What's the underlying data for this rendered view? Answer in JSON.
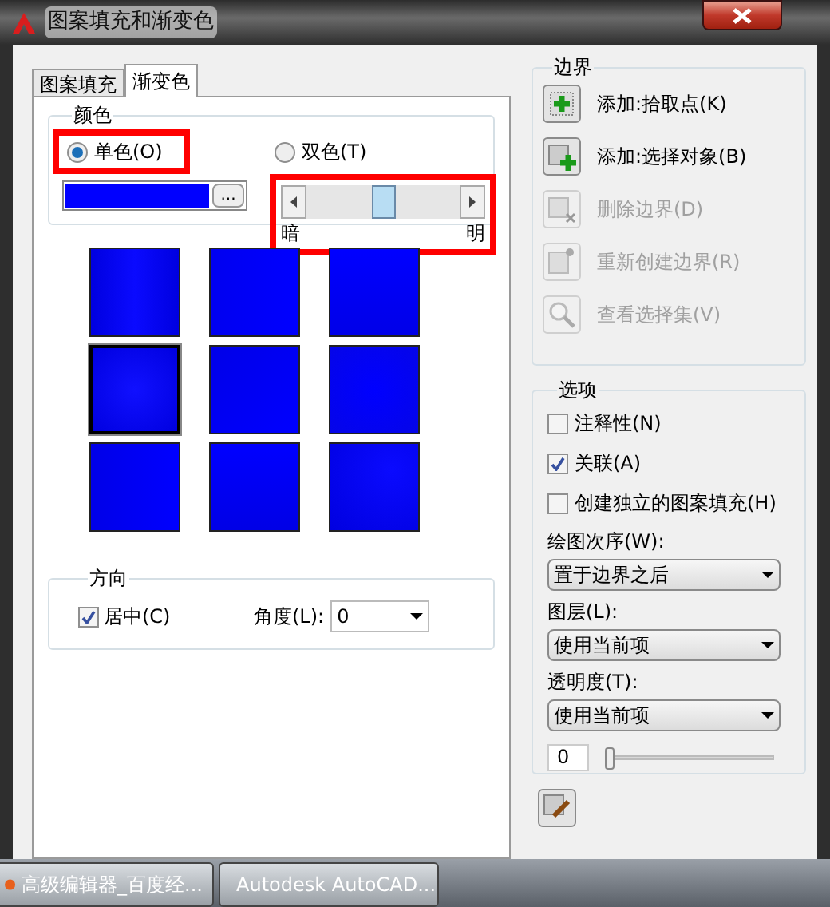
{
  "window": {
    "title": "图案填充和渐变色"
  },
  "tabs": [
    {
      "label": "图案填充",
      "selected": false
    },
    {
      "label": "渐变色",
      "selected": true
    }
  ],
  "color": {
    "title": "颜色",
    "options": [
      {
        "label": "单色(O)",
        "selected": true,
        "highlighted": true
      },
      {
        "label": "双色(T)",
        "selected": false,
        "highlighted": false
      }
    ],
    "color": "#0000ff",
    "browse_button": "...",
    "shade_slider": {
      "level": 0.5,
      "left_label": "暗",
      "right_label": "明",
      "highlighted": true
    }
  },
  "swatches": [
    {
      "selected": false
    },
    {
      "selected": false
    },
    {
      "selected": false
    },
    {
      "selected": true
    },
    {
      "selected": false
    },
    {
      "selected": false
    },
    {
      "selected": false
    },
    {
      "selected": false
    },
    {
      "selected": false
    }
  ],
  "direction": {
    "title": "方向",
    "centered": {
      "label": "居中(C)",
      "checked": true
    },
    "angle": {
      "label": "角度(L):",
      "value": "0"
    }
  },
  "boundary": {
    "title": "边界",
    "buttons": [
      {
        "kind": "pick",
        "label": "添加:拾取点(K)",
        "disabled": false
      },
      {
        "kind": "select",
        "label": "添加:选择对象(B)",
        "disabled": false
      },
      {
        "kind": "remove",
        "label": "删除边界(D)",
        "disabled": true
      },
      {
        "kind": "recreate",
        "label": "重新创建边界(R)",
        "disabled": true
      },
      {
        "kind": "view",
        "label": "查看选择集(V)",
        "disabled": true
      }
    ]
  },
  "options": {
    "title": "选项",
    "checkboxes": [
      {
        "label": "注释性(N)",
        "checked": false
      },
      {
        "label": "关联(A)",
        "checked": true
      },
      {
        "label": "创建独立的图案填充(H)",
        "checked": false
      }
    ],
    "dropdowns": [
      {
        "label": "绘图次序(W):",
        "value": "置于边界之后"
      },
      {
        "label": "图层(L):",
        "value": "使用当前项"
      },
      {
        "label": "透明度(T):",
        "value": "使用当前项"
      }
    ],
    "transparency_value": "0",
    "transparency_slider": {
      "level": 0
    }
  },
  "taskbar": [
    {
      "kind": "browser",
      "label": "高级编辑器_百度经..."
    },
    {
      "kind": "autocad",
      "label": "Autodesk AutoCAD..."
    }
  ]
}
